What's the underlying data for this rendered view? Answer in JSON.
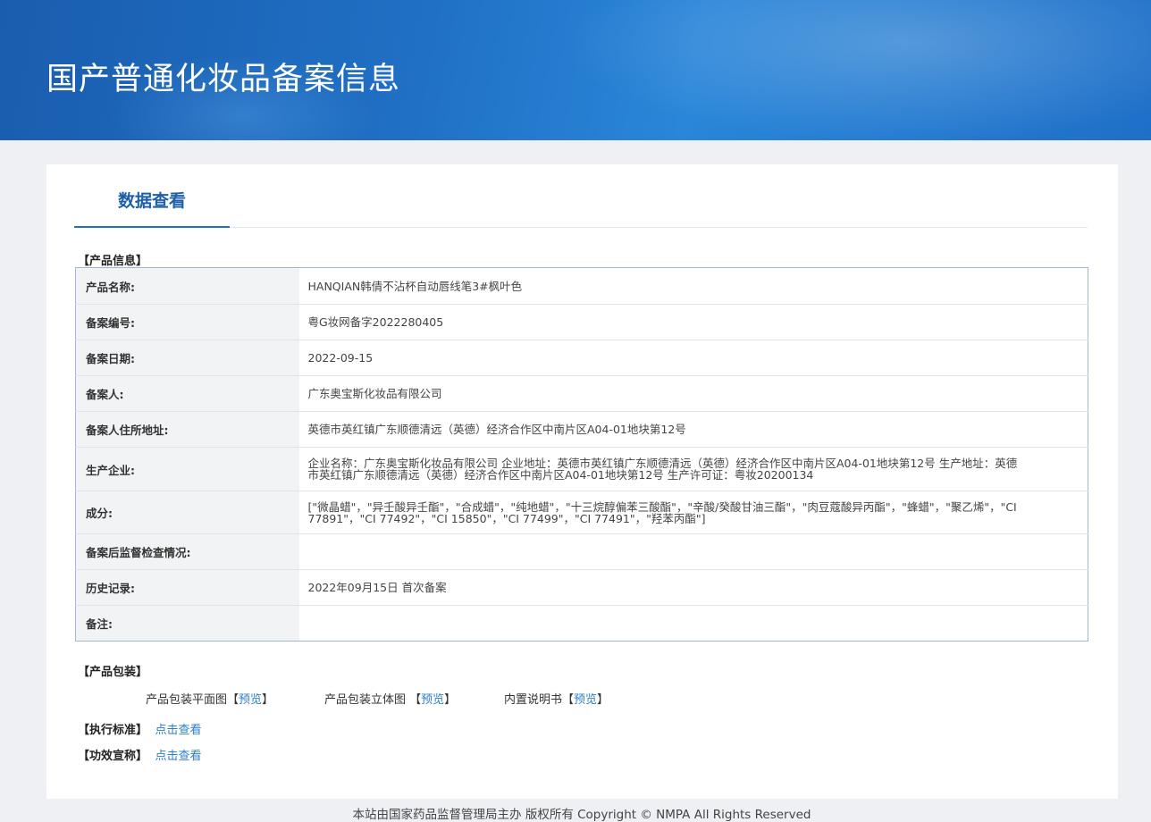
{
  "header": {
    "title": "国产普通化妆品备案信息"
  },
  "tabs": {
    "active_label": "数据查看"
  },
  "product_info": {
    "section_label": "【产品信息】",
    "rows": [
      {
        "label": "产品名称:",
        "value": "HANQIAN韩倩不沾杯自动唇线笔3#枫叶色"
      },
      {
        "label": "备案编号:",
        "value": "粤G妆网备字2022280405"
      },
      {
        "label": "备案日期:",
        "value": "2022-09-15"
      },
      {
        "label": "备案人:",
        "value": "广东奥宝斯化妆品有限公司"
      },
      {
        "label": "备案人住所地址:",
        "value": "英德市英红镇广东顺德清远（英德）经济合作区中南片区A04-01地块第12号"
      },
      {
        "label": "生产企业:",
        "value": "企业名称：广东奥宝斯化妆品有限公司 企业地址：英德市英红镇广东顺德清远（英德）经济合作区中南片区A04-01地块第12号 生产地址：英德市英红镇广东顺德清远（英德）经济合作区中南片区A04-01地块第12号 生产许可证：粤妆20200134"
      },
      {
        "label": "成分:",
        "value": "[\"微晶蜡\"，\"异壬酸异壬酯\"，\"合成蜡\"，\"纯地蜡\"，\"十三烷醇偏苯三酸酯\"，\"辛酸/癸酸甘油三酯\"，\"肉豆蔻酸异丙酯\"，\"蜂蜡\"，\"聚乙烯\"，\"CI 77891\"，\"CI 77492\"，\"CI 15850\"，\"CI 77499\"，\"CI 77491\"，\"羟苯丙酯\"]"
      },
      {
        "label": "备案后监督检查情况:",
        "value": ""
      },
      {
        "label": "历史记录:",
        "value": "2022年09月15日 首次备案"
      },
      {
        "label": "备注:",
        "value": ""
      }
    ]
  },
  "packaging": {
    "section_label": "【产品包装】",
    "items": [
      {
        "label": "产品包装平面图",
        "open": "【",
        "link": "预览",
        "close": "】"
      },
      {
        "label": "产品包装立体图 ",
        "open": "【",
        "link": "预览",
        "close": "】"
      },
      {
        "label": "内置说明书",
        "open": "【",
        "link": "预览",
        "close": "】"
      }
    ]
  },
  "standard": {
    "section_label": "【执行标准】",
    "link": "点击查看"
  },
  "efficacy": {
    "section_label": "【功效宣称】",
    "link": "点击查看"
  },
  "footer": {
    "text": "本站由国家药品监督管理局主办 版权所有 Copyright © NMPA All Rights Reserved"
  },
  "colors": {
    "banner": "#1f6fc4",
    "accent": "#1f5fa8",
    "link": "#2b7fc8"
  }
}
